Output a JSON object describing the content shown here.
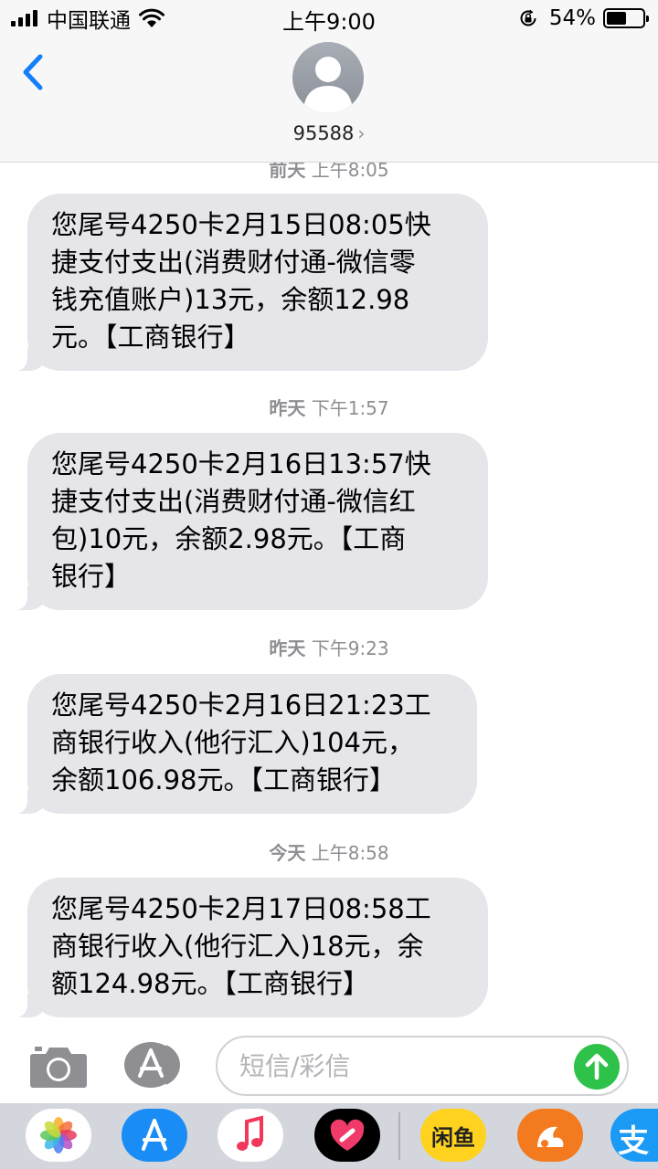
{
  "status_bar": {
    "carrier": "中国联通",
    "time": "上午9:00",
    "battery_percent": "54%",
    "battery_level": 0.54,
    "icons": [
      "signal-icon",
      "wifi-icon",
      "rotation-lock-icon",
      "battery-icon"
    ]
  },
  "header": {
    "contact": "95588",
    "chevron": "›",
    "icons": [
      "back-chevron-icon",
      "contact-avatar-icon"
    ]
  },
  "messages": [
    {
      "timestamp_day": "前天",
      "timestamp_time": "上午8:05",
      "lines": [
        "您尾号4250卡2月15日08:05快",
        "捷支付支出(消费财付通-微信零",
        "钱充值账户)13元，余额12.98",
        "元。【工商银行】"
      ]
    },
    {
      "timestamp_day": "昨天",
      "timestamp_time": "下午1:57",
      "lines": [
        "您尾号4250卡2月16日13:57快",
        "捷支付支出(消费财付通-微信红",
        "包)10元，余额2.98元。【工商",
        "银行】"
      ]
    },
    {
      "timestamp_day": "昨天",
      "timestamp_time": "下午9:23",
      "lines": [
        "您尾号4250卡2月16日21:23工",
        "商银行收入(他行汇入)104元，",
        "余额106.98元。【工商银行】"
      ]
    },
    {
      "timestamp_day": "今天",
      "timestamp_time": "上午8:58",
      "lines": [
        "您尾号4250卡2月17日08:58工",
        "商银行收入(他行汇入)18元，余",
        "额124.98元。【工商银行】"
      ]
    }
  ],
  "input": {
    "placeholder": "短信/彩信",
    "icons": [
      "camera-icon",
      "app-store-icon",
      "send-arrow-icon"
    ]
  },
  "app_drawer": {
    "xianyu_label": "闲鱼",
    "apps": [
      "photos-icon",
      "app-store-icon",
      "music-icon",
      "digital-touch-icon",
      "xianyu-icon",
      "uc-browser-icon",
      "alipay-icon"
    ],
    "alipay_glyph": "支"
  },
  "colors": {
    "bubble": "#e5e5ea",
    "send": "#2fc24a",
    "ios_blue": "#147efb",
    "timestamp": "#8e8e93"
  }
}
